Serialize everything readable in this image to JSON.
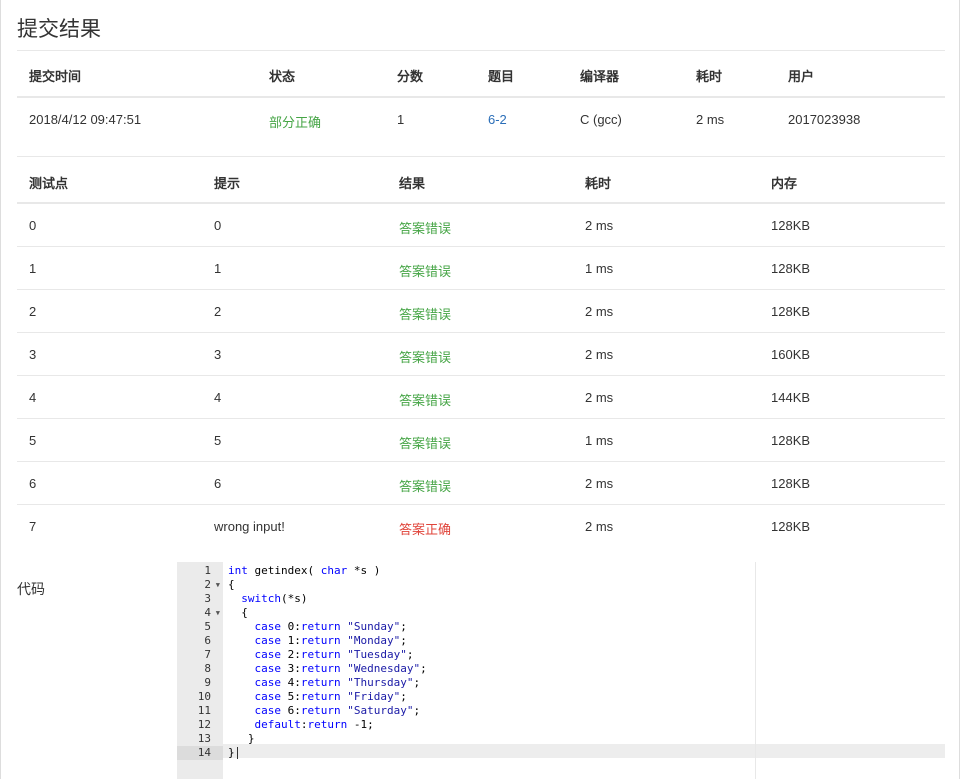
{
  "page": {
    "title": "提交结果"
  },
  "submission": {
    "headers": [
      "提交时间",
      "状态",
      "分数",
      "题目",
      "编译器",
      "耗时",
      "用户"
    ],
    "row": {
      "time": "2018/4/12 09:47:51",
      "status": "部分正确",
      "score": "1",
      "problem": "6-2",
      "compiler": "C (gcc)",
      "duration": "2 ms",
      "user": "2017023938"
    }
  },
  "testcases": {
    "headers": [
      "测试点",
      "提示",
      "结果",
      "耗时",
      "内存"
    ],
    "rows": [
      {
        "id": "0",
        "hint": "0",
        "result": "答案错误",
        "time": "2 ms",
        "mem": "128KB"
      },
      {
        "id": "1",
        "hint": "1",
        "result": "答案错误",
        "time": "1 ms",
        "mem": "128KB"
      },
      {
        "id": "2",
        "hint": "2",
        "result": "答案错误",
        "time": "2 ms",
        "mem": "128KB"
      },
      {
        "id": "3",
        "hint": "3",
        "result": "答案错误",
        "time": "2 ms",
        "mem": "160KB"
      },
      {
        "id": "4",
        "hint": "4",
        "result": "答案错误",
        "time": "2 ms",
        "mem": "144KB"
      },
      {
        "id": "5",
        "hint": "5",
        "result": "答案错误",
        "time": "1 ms",
        "mem": "128KB"
      },
      {
        "id": "6",
        "hint": "6",
        "result": "答案错误",
        "time": "2 ms",
        "mem": "128KB"
      },
      {
        "id": "7",
        "hint": "wrong input!",
        "result": "答案正确",
        "time": "2 ms",
        "mem": "128KB"
      }
    ]
  },
  "code": {
    "label": "代码",
    "line_numbers": [
      "1",
      "2",
      "3",
      "4",
      "5",
      "6",
      "7",
      "8",
      "9",
      "10",
      "11",
      "12",
      "13",
      "14"
    ],
    "lines": [
      "int getindex( char *s )",
      "{",
      "  switch(*s)",
      "  {",
      "    case 0:return \"Sunday\";",
      "    case 1:return \"Monday\";",
      "    case 2:return \"Tuesday\";",
      "    case 3:return \"Wednesday\";",
      "    case 4:return \"Thursday\";",
      "    case 5:return \"Friday\";",
      "    case 6:return \"Saturday\";",
      "    default:return -1;",
      "   }",
      "}"
    ]
  },
  "colors": {
    "accepted": "#46a546",
    "wrong": "#e0443a",
    "link": "#2a6eb8",
    "keyword": "#0000ff",
    "string": "#1a1aa6"
  }
}
